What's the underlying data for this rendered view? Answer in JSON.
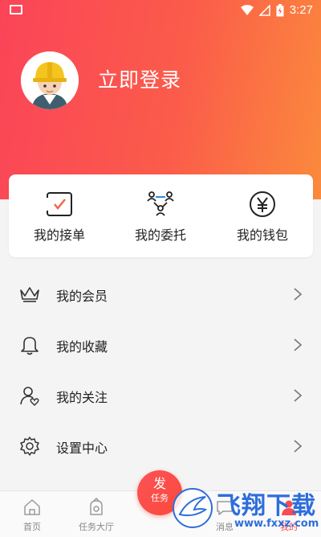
{
  "status_bar": {
    "time": "3:27"
  },
  "header": {
    "login_label": "立即登录"
  },
  "quick_actions": [
    {
      "label": "我的接单",
      "icon": "order-check-icon"
    },
    {
      "label": "我的委托",
      "icon": "delegate-people-icon"
    },
    {
      "label": "我的钱包",
      "icon": "wallet-yen-icon"
    }
  ],
  "menu": [
    {
      "label": "我的会员",
      "icon": "crown-icon"
    },
    {
      "label": "我的收藏",
      "icon": "bell-icon"
    },
    {
      "label": "我的关注",
      "icon": "follow-person-icon"
    },
    {
      "label": "设置中心",
      "icon": "gear-icon"
    }
  ],
  "tabbar": {
    "tabs": [
      {
        "label": "首页",
        "icon": "home-icon"
      },
      {
        "label": "任务大厅",
        "icon": "task-hall-icon"
      },
      {
        "label": "消息",
        "icon": "message-icon"
      },
      {
        "label": "我的",
        "icon": "profile-icon"
      }
    ],
    "fab": {
      "line1": "发",
      "line2": "任务"
    }
  },
  "watermark": {
    "text": "飞翔下载",
    "sub": "www.fxxz.com"
  },
  "colors": {
    "accent": "#fb4a52",
    "header_gradient_end": "#fb8a3c"
  }
}
